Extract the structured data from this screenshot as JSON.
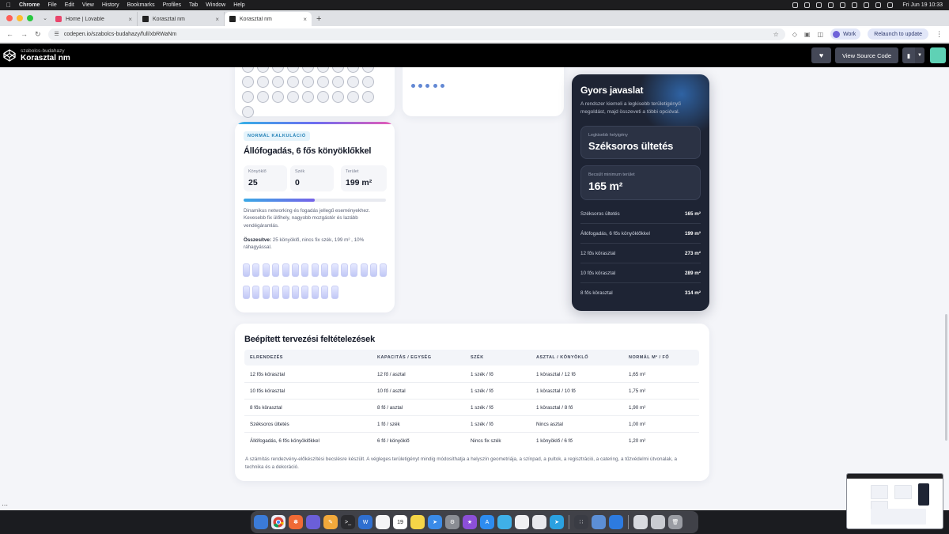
{
  "menubar": {
    "app_name": "Chrome",
    "menus": [
      "File",
      "Edit",
      "View",
      "History",
      "Bookmarks",
      "Profiles",
      "Tab",
      "Window",
      "Help"
    ],
    "datetime": "Fri Jun 19  10:33"
  },
  "browser": {
    "tabs": [
      {
        "title": "Home | Lovable",
        "active": false
      },
      {
        "title": "Korasztal nm",
        "active": false
      },
      {
        "title": "Korasztal nm",
        "active": true
      }
    ],
    "url": "codepen.io/szabolcs-budahazy/full/xbRWaNm",
    "profile_label": "Work",
    "relaunch_label": "Relaunch to update"
  },
  "codepen": {
    "author": "szabolcs-budahazy",
    "pen_title": "Korasztal nm",
    "view_source_label": "View Source Code"
  },
  "calc_card": {
    "badge": "NORMÁL KALKULÁCIÓ",
    "title": "Állófogadás, 6 fős könyöklőkkel",
    "stats": [
      {
        "label": "Könyöklő",
        "value": "25"
      },
      {
        "label": "Szék",
        "value": "0"
      },
      {
        "label": "Terület",
        "value": "199 m²"
      }
    ],
    "progress_fraction": 0.5,
    "description": "Dinamikus networking és fogadás jellegű eseményekhez. Kevesebb fix ülőhely, nagyobb mozgástér és lazább vendégáramlás.",
    "summary_label": "Összesítve:",
    "summary_text": " 25 könyöklő, nincs fix szék, 199 m² , 10% ráhagyással.",
    "pill_count": 25
  },
  "circles_card": {
    "circle_count": 28
  },
  "dots_card": {
    "dot_count": 23
  },
  "quick_panel": {
    "title": "Gyors javaslat",
    "description": "A rendszer kiemeli a legkisebb területigényű megoldást, majd összeveti a többi opcióval.",
    "best_label": "Legkisebb helyigény",
    "best_value": "Széksoros ültetés",
    "min_area_label": "Becsült minimum terület",
    "min_area_value": "165 m²",
    "ranking": [
      {
        "name": "Széksoros ültetés",
        "value": "165 m²"
      },
      {
        "name": "Állófogadás, 6 fős könyöklőkkel",
        "value": "199 m²"
      },
      {
        "name": "12 fős körasztal",
        "value": "273 m²"
      },
      {
        "name": "10 fős körasztal",
        "value": "289 m²"
      },
      {
        "name": "8 fős körasztal",
        "value": "314 m²"
      }
    ]
  },
  "assumptions": {
    "title": "Beépített tervezési feltételezések",
    "headers": [
      "ELRENDEZÉS",
      "KAPACITÁS / EGYSÉG",
      "SZÉK",
      "ASZTAL / KÖNYÖKLŐ",
      "NORMÁL M² / FŐ"
    ],
    "rows": [
      [
        "12 fős körasztal",
        "12 fő / asztal",
        "1 szék / fő",
        "1 körasztal / 12 fő",
        "1,65 m²"
      ],
      [
        "10 fős körasztal",
        "10 fő / asztal",
        "1 szék / fő",
        "1 körasztal / 10 fő",
        "1,75 m²"
      ],
      [
        "8 fős körasztal",
        "8 fő / asztal",
        "1 szék / fő",
        "1 körasztal / 8 fő",
        "1,90 m²"
      ],
      [
        "Széksoros ültetés",
        "1 fő / szék",
        "1 szék / fő",
        "Nincs asztal",
        "1,00 m²"
      ],
      [
        "Állófogadás, 6 fős könyöklőkkel",
        "6 fő / könyöklő",
        "Nincs fix szék",
        "1 könyöklő / 6 fő",
        "1,20 m²"
      ]
    ],
    "footnote": "A számítás rendezvény-előkészítési becslésre készült. A végleges területigényt mindig módosíthatja a helyszín geometriája, a színpad, a pultok, a regisztráció, a catering, a tűzvédelmi útvonalak, a technika és a dekoráció."
  },
  "colors": {
    "accent_blue": "#3aa8e6",
    "accent_purple": "#7663e8",
    "dark_panel": "#1e2434",
    "page_bg": "#f4f5f9"
  }
}
